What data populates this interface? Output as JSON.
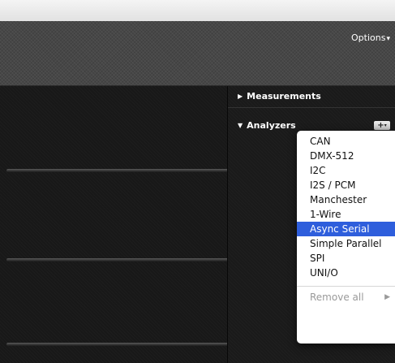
{
  "toolbar": {
    "options_label": "Options",
    "options_caret": "▾"
  },
  "sidebar": {
    "measurements": {
      "label": "Measurements",
      "expanded": false,
      "icon": "triangle-right-icon"
    },
    "analyzers": {
      "label": "Analyzers",
      "expanded": true,
      "icon": "triangle-down-icon",
      "add_button_label": "+",
      "add_button_caret": "▾"
    }
  },
  "analyzer_menu": {
    "items": [
      {
        "label": "CAN",
        "selected": false
      },
      {
        "label": "DMX-512",
        "selected": false
      },
      {
        "label": "I2C",
        "selected": false
      },
      {
        "label": "I2S / PCM",
        "selected": false
      },
      {
        "label": "Manchester",
        "selected": false
      },
      {
        "label": "1-Wire",
        "selected": false
      },
      {
        "label": "Async Serial",
        "selected": true
      },
      {
        "label": "Simple Parallel",
        "selected": false
      },
      {
        "label": "SPI",
        "selected": false
      },
      {
        "label": "UNI/O",
        "selected": false
      }
    ],
    "remove_all_label": "Remove all",
    "remove_all_enabled": false,
    "submenu_arrow": "▶"
  },
  "colors": {
    "selection": "#2e5edc",
    "toolbar": "#474747",
    "background": "#161616"
  }
}
